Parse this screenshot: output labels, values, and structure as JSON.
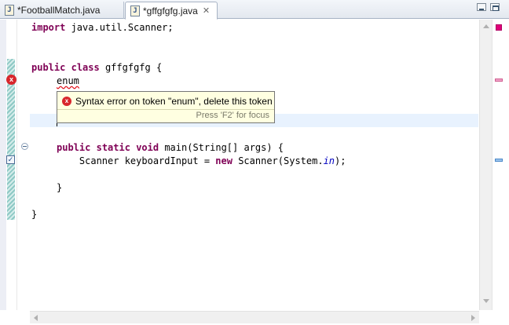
{
  "tabs": [
    {
      "label": "*FootballMatch.java",
      "icon": "java-file-icon",
      "active": false
    },
    {
      "label": "*gffgfgfg.java",
      "icon": "java-file-icon",
      "active": true,
      "close": "✕"
    }
  ],
  "editor": {
    "lines": {
      "l1_kw": "import",
      "l1_rest": " java.util.Scanner;",
      "l3_kw1": "public",
      "l3_kw2": "class",
      "l3_rest": " gffgfgfg {",
      "l4_err": "enum",
      "l7_kw1": "public",
      "l7_kw2": "static",
      "l7_kw3": "void",
      "l7_rest": " main(String[] args) {",
      "l8_a": "    Scanner keyboardInput = ",
      "l8_kw": "new",
      "l8_b": " Scanner(System.",
      "l8_field": "in",
      "l8_c": ");",
      "l10": "}",
      "l12": "}"
    }
  },
  "tooltip": {
    "message": "Syntax error on token \"enum\", delete this token",
    "focus_hint": "Press 'F2' for focus"
  },
  "colors": {
    "keyword": "#7f0055",
    "static_field": "#0000c0",
    "error": "#d8262c",
    "current_line": "#e8f2fe",
    "tooltip_bg": "#ffffe1"
  },
  "icons": {
    "file": "java-file-icon",
    "error": "error-icon",
    "task": "task-icon",
    "fold": "fold-minus-icon"
  }
}
